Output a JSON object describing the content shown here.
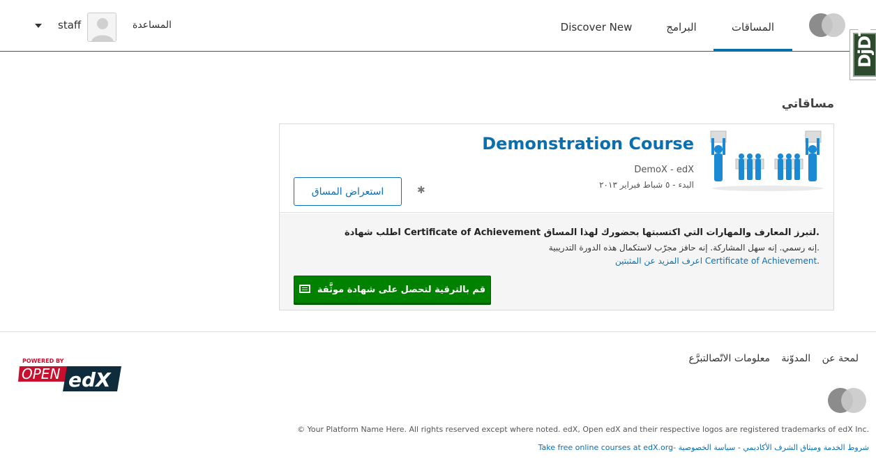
{
  "header": {
    "nav": {
      "courses": "المساقات",
      "programs": "البرامج",
      "discover": "Discover New"
    },
    "help": "المساعدة",
    "username": "staff",
    "debug_toolbar": "DjDT"
  },
  "main": {
    "section_title": "مساقاتي",
    "course": {
      "title": "Demonstration Course",
      "org": "DemoX - edX",
      "start": "البدء - ٥ شباط فبراير ٢٠١٣",
      "view_button": "استعراض المساق"
    },
    "certificate": {
      "title": "اطلب شهادة Certificate of Achievement لتبرز المعارف والمهارات التي اكتسبتها بحضورك لهذا المساق.",
      "body": "إنه رسمي. إنه سهل المشاركة. إنه حافز مجرّب لاستكمال هذه الدورة التدريبية.",
      "link": "اعرف المزيد عن المثبتين Certificate of Achievement",
      "link_suffix": ".",
      "upgrade_button": "قم بالترقية لتحصل على شهادة موثَّقة"
    }
  },
  "footer": {
    "nav": {
      "about": "لمحة عن",
      "blog": "المدوّنة",
      "contact": "معلومات الاتّصال",
      "donate": "تبرَّع"
    },
    "copyright": "© Your Platform Name Here. All rights reserved except where noted. edX, Open edX and their respective logos are registered trademarks of edX Inc.",
    "legal": {
      "tos": "شروط الخدمة وميثاق الشرف الأكاديمي",
      "sep1": " - ",
      "privacy": "سياسة الخصوصية",
      "sep2": " -",
      "edx_link": "Take free online courses at edX.org"
    },
    "powered": {
      "powered_by": "POWERED BY",
      "open": "OPEN",
      "edx": "edX"
    }
  }
}
